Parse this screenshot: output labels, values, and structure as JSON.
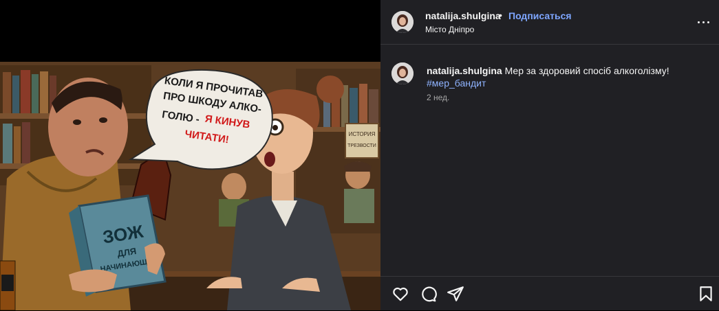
{
  "post": {
    "author": "natalija.shulgina",
    "dot": "•",
    "follow_label": "Подписаться",
    "location": "Місто Дніпро",
    "caption": {
      "author": "natalija.shulgina",
      "text": "Мер за здоровий спосіб алкоголізму!",
      "hashtag": "#мер_бандит"
    },
    "time": "2 нед."
  },
  "image": {
    "bubble_lines": [
      "КОЛИ Я ПРОЧИТАВ",
      "ПРО ШКОДУ АЛКО-",
      "ГОЛЮ -"
    ],
    "bubble_red_1": "Я КИНУВ",
    "bubble_red_2": "ЧИТАТИ!",
    "book_title": "ЗОЖ",
    "book_sub_1": "ДЛЯ",
    "book_sub_2": "НАЧИНАЮЩИХ",
    "sign_1": "ИСТОРИЯ",
    "sign_2": "ТРЕЗВОСТИ"
  },
  "icons": {
    "more": "more-horizontal-icon",
    "like": "heart-icon",
    "comment": "comment-icon",
    "share": "send-icon",
    "save": "bookmark-icon"
  },
  "colors": {
    "panel_bg": "#202024",
    "follow": "#7ea6ff",
    "hashtag": "#8fb3ff",
    "muted": "#a8a8a8"
  }
}
